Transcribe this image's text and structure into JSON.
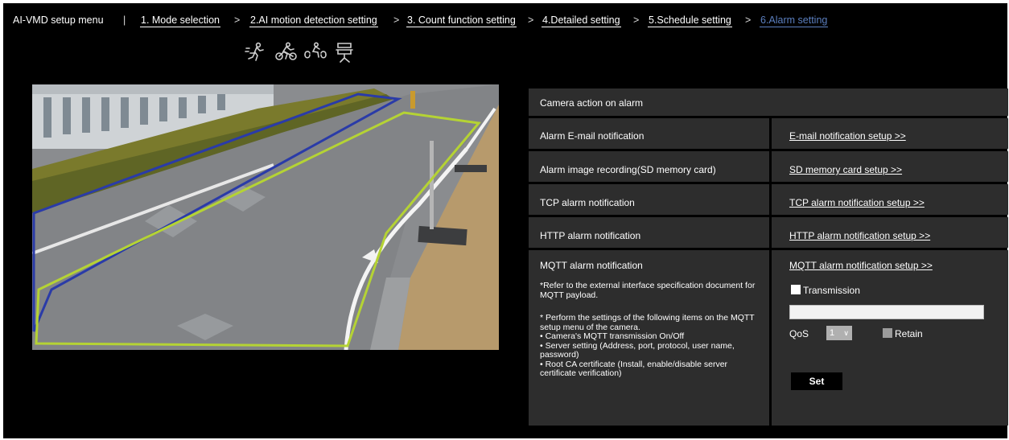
{
  "header": {
    "app_title": "AI-VMD setup menu",
    "divider": "|",
    "steps": [
      {
        "label": "1. Mode selection"
      },
      {
        "label": "2.AI motion detection setting"
      },
      {
        "label": "3. Count function setting"
      },
      {
        "label": "4.Detailed setting"
      },
      {
        "label": "5.Schedule setting"
      },
      {
        "label": "6.Alarm setting",
        "active": true
      }
    ],
    "separator": ">",
    "active_color": "#5b7fbf"
  },
  "target_icons": [
    "person-icon",
    "bicycle-icon",
    "motorcycle-icon",
    "vehicle-icon"
  ],
  "camera": {
    "zone_colors": {
      "zone_1": "#2a3ba8",
      "zone_2": "#b5d334"
    }
  },
  "settings": {
    "title": "Camera action on alarm",
    "rows": [
      {
        "label": "Alarm E-mail notification",
        "link": "E-mail notification setup >>"
      },
      {
        "label": "Alarm image recording(SD memory card)",
        "link": "SD memory card setup >>"
      },
      {
        "label": "TCP alarm notification",
        "link": "TCP alarm notification setup >>"
      },
      {
        "label": "HTTP alarm notification",
        "link": "HTTP alarm notification setup >>"
      }
    ],
    "mqtt": {
      "label": "MQTT alarm notification",
      "note_1": "*Refer to the external interface specification document for MQTT payload.",
      "note_2_lines": [
        "* Perform the settings of the following items on the MQTT setup menu of the camera.",
        "• Camera's MQTT transmission On/Off",
        "• Server setting (Address, port, protocol, user name, password)",
        "• Root CA certificate (Install, enable/disable server certificate verification)"
      ],
      "link": "MQTT alarm notification setup >>",
      "transmission_label": "Transmission",
      "topic_value": "",
      "qos_label": "QoS",
      "qos_value": "1",
      "retain_label": "Retain",
      "set_label": "Set"
    }
  }
}
